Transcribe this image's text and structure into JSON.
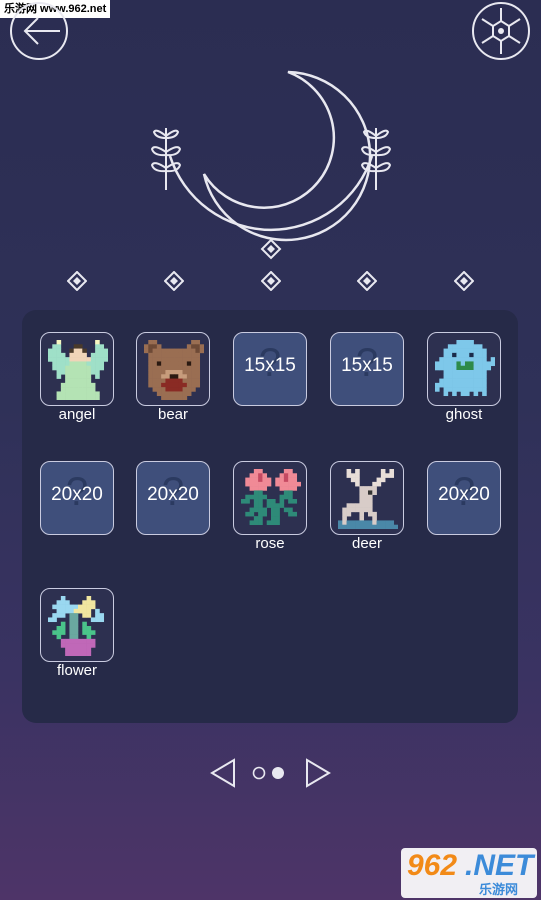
{
  "watermark": {
    "top": "乐游网 www.962.net",
    "brand_a": "962",
    "brand_b": ".NET",
    "brand_sub": "乐游网"
  },
  "header": {
    "back_icon": "arrow-left-icon",
    "settings_icon": "hexagon-ball-icon"
  },
  "emblem": {
    "icon": "crescent-moon-icon"
  },
  "level_dots": 5,
  "tiles": [
    {
      "type": "open",
      "label": "angel",
      "art": "angel"
    },
    {
      "type": "open",
      "label": "bear",
      "art": "bear"
    },
    {
      "type": "locked",
      "size": "15x15"
    },
    {
      "type": "locked",
      "size": "15x15"
    },
    {
      "type": "open",
      "label": "ghost",
      "art": "ghost"
    },
    {
      "type": "locked",
      "size": "20x20"
    },
    {
      "type": "locked",
      "size": "20x20"
    },
    {
      "type": "open",
      "label": "rose",
      "art": "rose"
    },
    {
      "type": "open",
      "label": "deer",
      "art": "deer"
    },
    {
      "type": "locked",
      "size": "20x20"
    },
    {
      "type": "open",
      "label": "flower",
      "art": "flower"
    }
  ],
  "pager": {
    "pages": 2,
    "current": 2
  },
  "colors": {
    "accent_line": "#e8e8f0",
    "locked_tile": "#3f4f7b",
    "panel": "#262a48"
  }
}
